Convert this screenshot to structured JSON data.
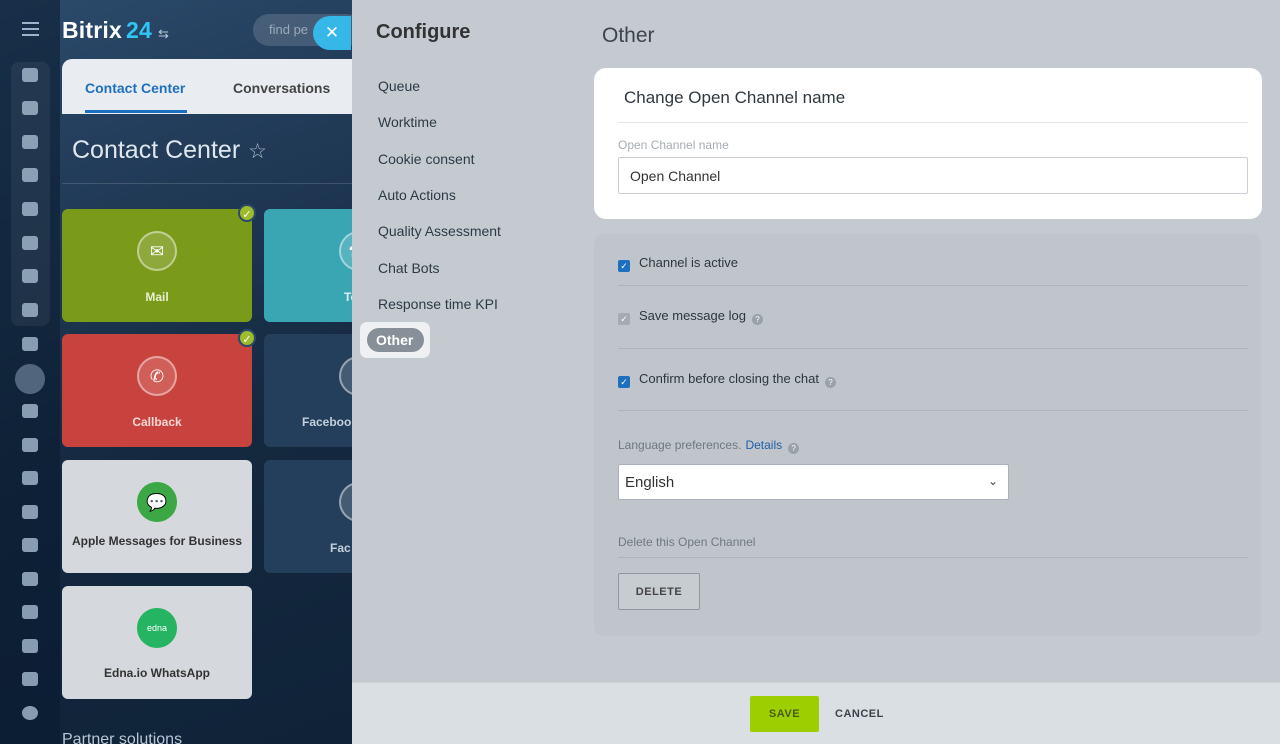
{
  "app": {
    "logo_main": "Bitrix",
    "logo_num": "24",
    "search_placeholder": "find pe",
    "tabs": [
      "Contact Center",
      "Conversations"
    ],
    "page_title": "Contact Center",
    "tiles": [
      {
        "label": "Mail",
        "color": "#7a9a1a",
        "checked": true
      },
      {
        "label": "Tele",
        "color": "#3aa6b4",
        "checked": false
      },
      {
        "label": "Callback",
        "color": "#c8433d",
        "checked": true
      },
      {
        "label": "Faceboo",
        "color": "#243f5c",
        "checked": false
      },
      {
        "label": "Apple Messages for Business",
        "color": "#d5d8dc",
        "checked": false
      },
      {
        "label": "Fac",
        "color": "#243f5c",
        "checked": false
      },
      {
        "label": "Edna.io WhatsApp",
        "color": "#d5d8dc",
        "checked": false
      }
    ],
    "partner_text": "Partner solutions"
  },
  "configure": {
    "title": "Configure",
    "items": [
      "Queue",
      "Worktime",
      "Cookie consent",
      "Auto Actions",
      "Quality Assessment",
      "Chat Bots",
      "Response time KPI"
    ],
    "active_item": "Other"
  },
  "content": {
    "title": "Other",
    "name_card": {
      "header": "Change Open Channel name",
      "field_label": "Open Channel name",
      "field_value": "Open Channel"
    },
    "options": {
      "channel_active": "Channel is active",
      "save_log": "Save message log",
      "confirm_close": "Confirm before closing the chat",
      "language_label": "Language preferences.",
      "language_link": "Details",
      "language_value": "English",
      "delete_label": "Delete this Open Channel",
      "delete_button": "DELETE"
    }
  },
  "footer": {
    "save": "SAVE",
    "cancel": "CANCEL"
  },
  "colors": {
    "accent": "#1f6fbf",
    "save_green": "#9dcf00",
    "close_blue": "#35b7e8"
  }
}
